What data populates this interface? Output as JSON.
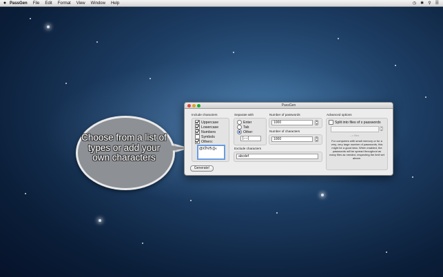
{
  "menubar": {
    "apple": "",
    "app_name": "PassGen",
    "items": [
      "File",
      "Edit",
      "Format",
      "View",
      "Window",
      "Help"
    ]
  },
  "callout": {
    "text": "Choose from a list of types or add your own characters"
  },
  "window": {
    "title": "PassGen",
    "include": {
      "heading": "Include characters",
      "uppercase": {
        "label": "Uppercase",
        "checked": true
      },
      "lowercase": {
        "label": "Lowercase",
        "checked": true
      },
      "numbers": {
        "label": "Numbers",
        "checked": true
      },
      "symbols": {
        "label": "Symbols",
        "checked": false
      },
      "others": {
        "label": "Others:",
        "checked": true
      },
      "others_value": "@€Î%¶‹[]«"
    },
    "generate_label": "Generate!",
    "separate": {
      "heading": "Separate with",
      "enter": "Enter",
      "tab": "Tab",
      "other": "Other:",
      "selected": "other",
      "other_value": "[----]"
    },
    "num_passwords": {
      "label": "Number of passwords",
      "value": "1000"
    },
    "num_chars": {
      "label": "Number of characters",
      "value": "1000"
    },
    "exclude": {
      "label": "Exclude characters",
      "value": "abcdef"
    },
    "advanced": {
      "heading": "Advanced options",
      "split_label": "Split into files of x passwords",
      "split_checked": false,
      "files_label": "--> files",
      "description": "For computers with small memory or for a very, very large number of passwords, this might be a good idea. When enabled, the passwords will be spread throughout as many files as needed, respecting the limit set above."
    }
  },
  "colors": {
    "close": "#e0443e",
    "minimize": "#dea123",
    "maximize": "#1aab29",
    "focus_ring": "#6a9be0"
  }
}
